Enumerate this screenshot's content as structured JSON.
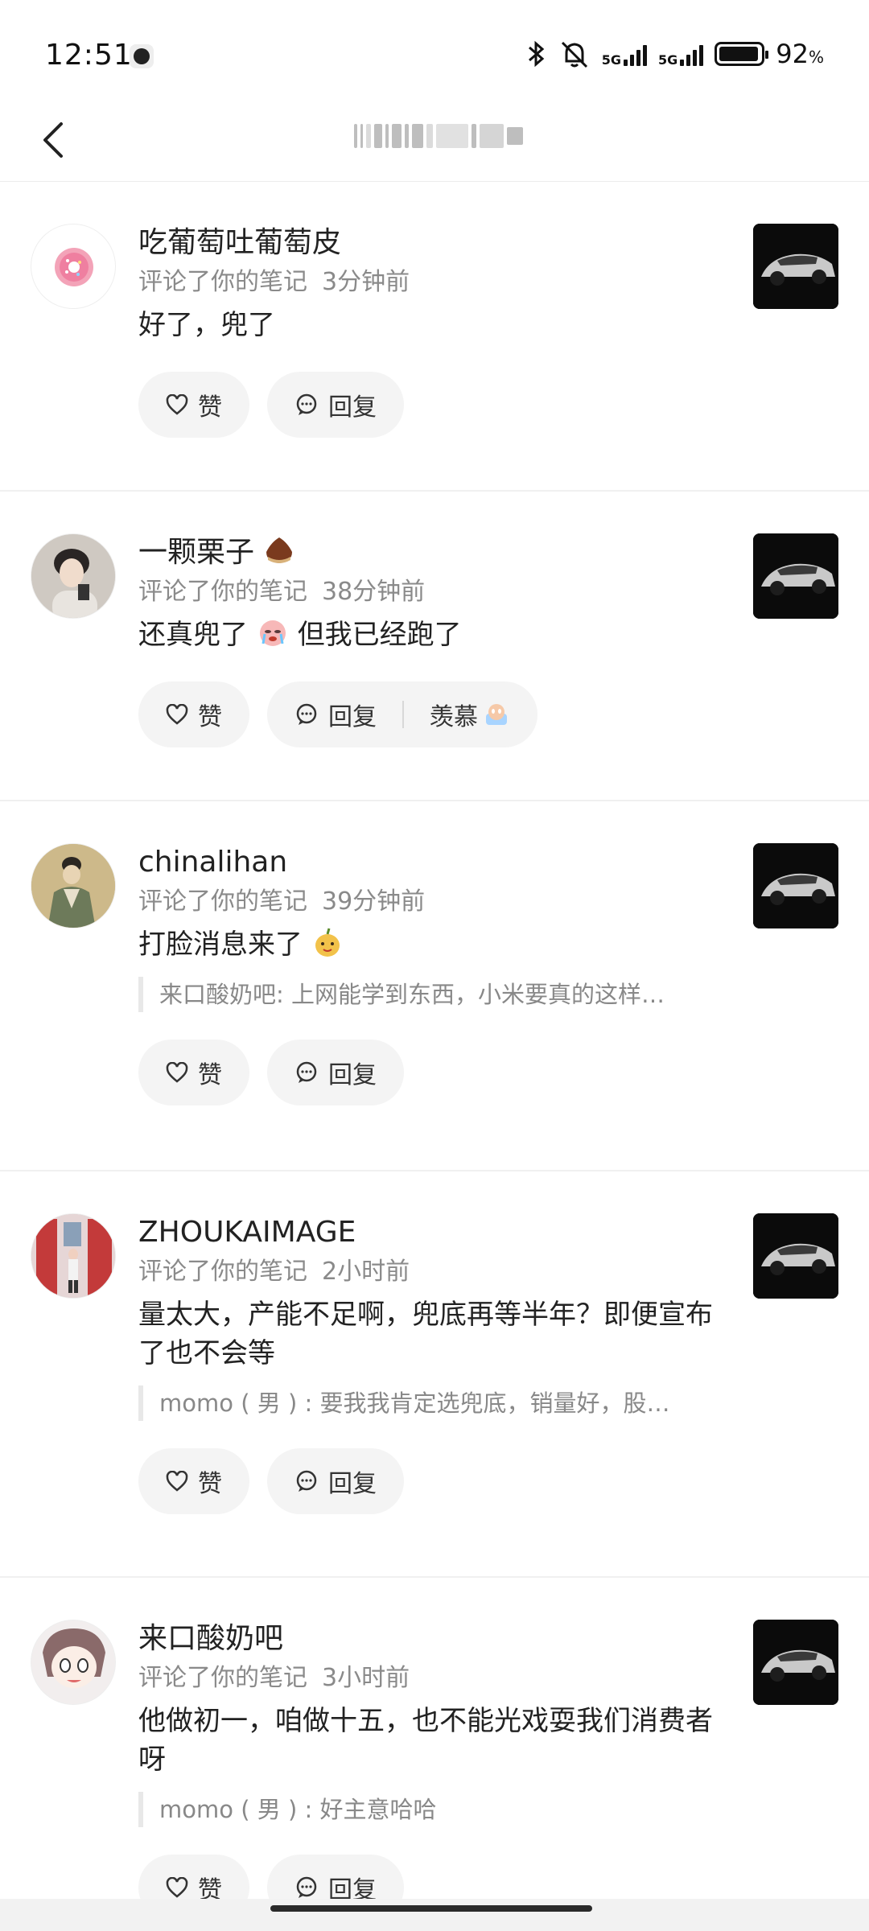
{
  "status_bar": {
    "time": "12:51",
    "network_1": "5G",
    "network_2": "5G",
    "battery_level": "92",
    "battery_unit": "%"
  },
  "nav": {
    "title": ""
  },
  "actions": {
    "like": "赞",
    "reply": "回复",
    "envy": "羡慕"
  },
  "items": [
    {
      "username": "吃葡萄吐葡萄皮",
      "meta": "评论了你的笔记",
      "time": "3分钟前",
      "comment": "好了，兜了",
      "quote": ""
    },
    {
      "username": "一颗栗子",
      "meta": "评论了你的笔记",
      "time": "38分钟前",
      "comment_a": "还真兜了",
      "comment_b": "但我已经跑了",
      "quote": ""
    },
    {
      "username": "chinalihan",
      "meta": "评论了你的笔记",
      "time": "39分钟前",
      "comment": "打脸消息来了",
      "quote": "来口酸奶吧: 上网能学到东西，小米要真的这样…"
    },
    {
      "username": "ZHOUKAIMAGE",
      "meta": "评论了你的笔记",
      "time": "2小时前",
      "comment": "量太大，产能不足啊，兜底再等半年？即便宣布了也不会等",
      "quote": "momo ( 男 ) : 要我我肯定选兜底，销量好，股…"
    },
    {
      "username": "来口酸奶吧",
      "meta": "评论了你的笔记",
      "time": "3小时前",
      "comment": "他做初一，咱做十五，也不能光戏耍我们消费者呀",
      "quote": "momo ( 男 ) : 好主意哈哈"
    }
  ],
  "colors": {
    "text": "#222222",
    "meta": "#8a8a8a",
    "pill_bg": "#f4f4f4"
  }
}
